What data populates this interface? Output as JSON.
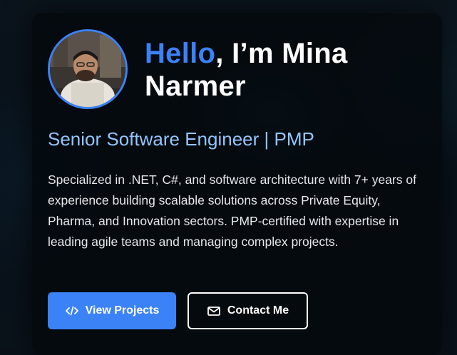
{
  "hero": {
    "greeting_accent": "Hello",
    "greeting_rest": ", I’m Mina Narmer",
    "subtitle": "Senior Software Engineer | PMP",
    "description": "Specialized in .NET, C#, and software architecture with 7+ years of experience building scalable solutions across Private Equity, Pharma, and Innovation sectors. PMP-certified with expertise in leading agile teams and managing complex projects."
  },
  "buttons": {
    "view_projects": {
      "label": "View Projects",
      "icon": "code-icon"
    },
    "contact_me": {
      "label": "Contact Me",
      "icon": "mail-icon"
    }
  },
  "colors": {
    "accent": "#3b82f6",
    "subtitle": "#93c5fd",
    "card_bg": "#04080c"
  }
}
